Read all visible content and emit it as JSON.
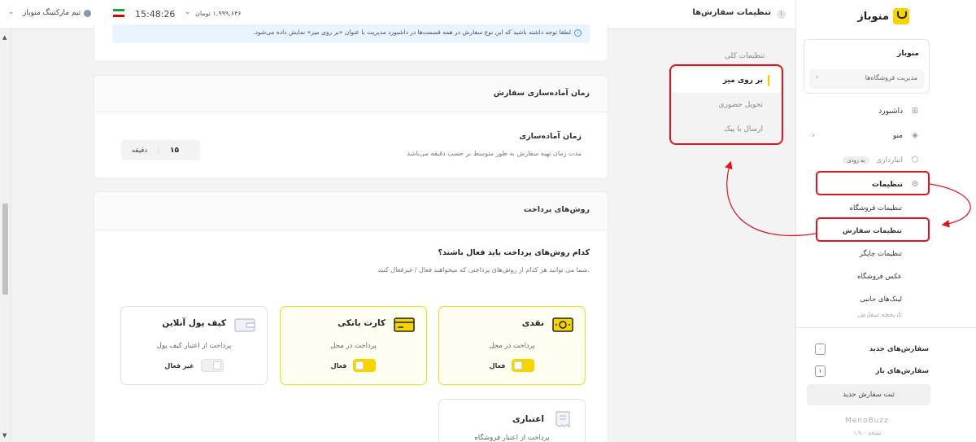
{
  "topbar": {
    "page_title": "تنظیمات سفارش‌ها",
    "info": "i",
    "balance": "۱,۹۹۹,۶۴۶ تومان",
    "clock": "15:48:26",
    "user_name": "تیم مارکتینگ منوباز"
  },
  "notice": {
    "text": "لطفا توجه داشته باشید که این نوع سفارش در همه قسمت‌ها در داشبورد مدیریت با عنوان «بر روی میز» نمایش داده می‌شود."
  },
  "prep": {
    "header": "زمان آماده‌سازی سفارش",
    "label": "زمان آماده‌سازی",
    "desc": "مدت زمان تهیه سفارش به طور متوسط بر حسب دقیقه می‌باشد",
    "value": "۱۵",
    "unit": "دقیقه"
  },
  "payment": {
    "header": "روش‌های پرداخت",
    "question": "کدام روش‌های پرداخت باید فعال باشند؟",
    "desc": "شما می توانید هر کدام از روش‌های پرداختی که میخواهید فعال / غیرفعال کنید.",
    "methods": [
      {
        "name": "نقدی",
        "desc": "پرداخت در محل",
        "status": "فعال",
        "icon": "cash-icon"
      },
      {
        "name": "کارت بانکی",
        "desc": "پرداخت در محل",
        "status": "فعال",
        "icon": "card-icon"
      },
      {
        "name": "کیف پول آنلاین",
        "desc": "پرداخت از اعتبار کیف پول",
        "status": "غیر فعال",
        "icon": "wallet-icon"
      },
      {
        "name": "اعتباری",
        "desc": "پرداخت از اعتبار فروشگاه",
        "icon": "receipt-icon"
      }
    ]
  },
  "settings_menu": {
    "title": "تنظیمات کلی",
    "items": [
      "بر روی میز",
      "تحویل حضوری",
      "ارسال با پیک"
    ]
  },
  "sidebar": {
    "logo": "منوباز",
    "store_name": "منوباز",
    "store_mgmt": "مدیریت فروشگاه‌ها",
    "nav": [
      {
        "label": "داشبورد",
        "icon": "grid-icon"
      },
      {
        "label": "منو",
        "icon": "layers-icon"
      },
      {
        "label": "انبارداری",
        "badge": "به زودی",
        "icon": "box-icon"
      },
      {
        "label": "تنظیمات",
        "icon": "gear-icon"
      }
    ],
    "sub": [
      "تنظیمات فروشگاه",
      "تنظیمات سفارش",
      "تنظیمات چاپگر",
      "عکس فروشگاه",
      "لینک‌های جانبی"
    ],
    "faded": "تاریخچه سفارش",
    "new_orders": "سفارش‌های جدید",
    "new_orders_count": "۰",
    "open_orders": "سفارش‌های باز",
    "open_orders_count": "۱",
    "new_order_btn": "ثبت سفارش جدید",
    "brand": "MenoBuzz",
    "version": "نسخه ۱.۹.۰"
  },
  "colors": {
    "accent": "#f5d400",
    "highlight": "#e0141e"
  }
}
